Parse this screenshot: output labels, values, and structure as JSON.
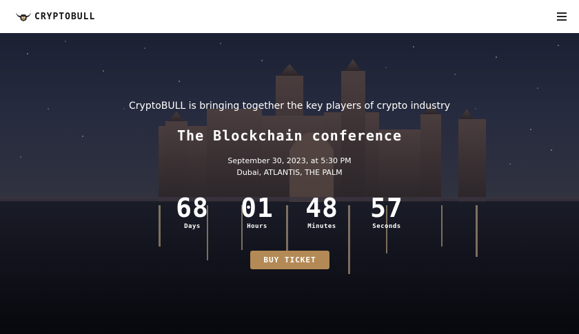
{
  "header": {
    "brand_name": "CRYPTOBULL",
    "logo_icon": "bull-head-icon",
    "menu_icon": "hamburger-menu-icon"
  },
  "hero": {
    "tagline": "CryptoBULL is bringing together the key players of crypto industry",
    "headline": "The Blockchain conference",
    "date": "September 30, 2023, at 5:30 PM",
    "location": "Dubai, ATLANTIS, THE PALM",
    "countdown": [
      {
        "value": "68",
        "label": "Days"
      },
      {
        "value": "01",
        "label": "Hours"
      },
      {
        "value": "48",
        "label": "Minutes"
      },
      {
        "value": "57",
        "label": "Seconds"
      }
    ],
    "cta_label": "BUY TICKET"
  },
  "colors": {
    "accent": "#b38a55",
    "hero_dark": "#1d2234",
    "text_light": "#ffffff"
  }
}
